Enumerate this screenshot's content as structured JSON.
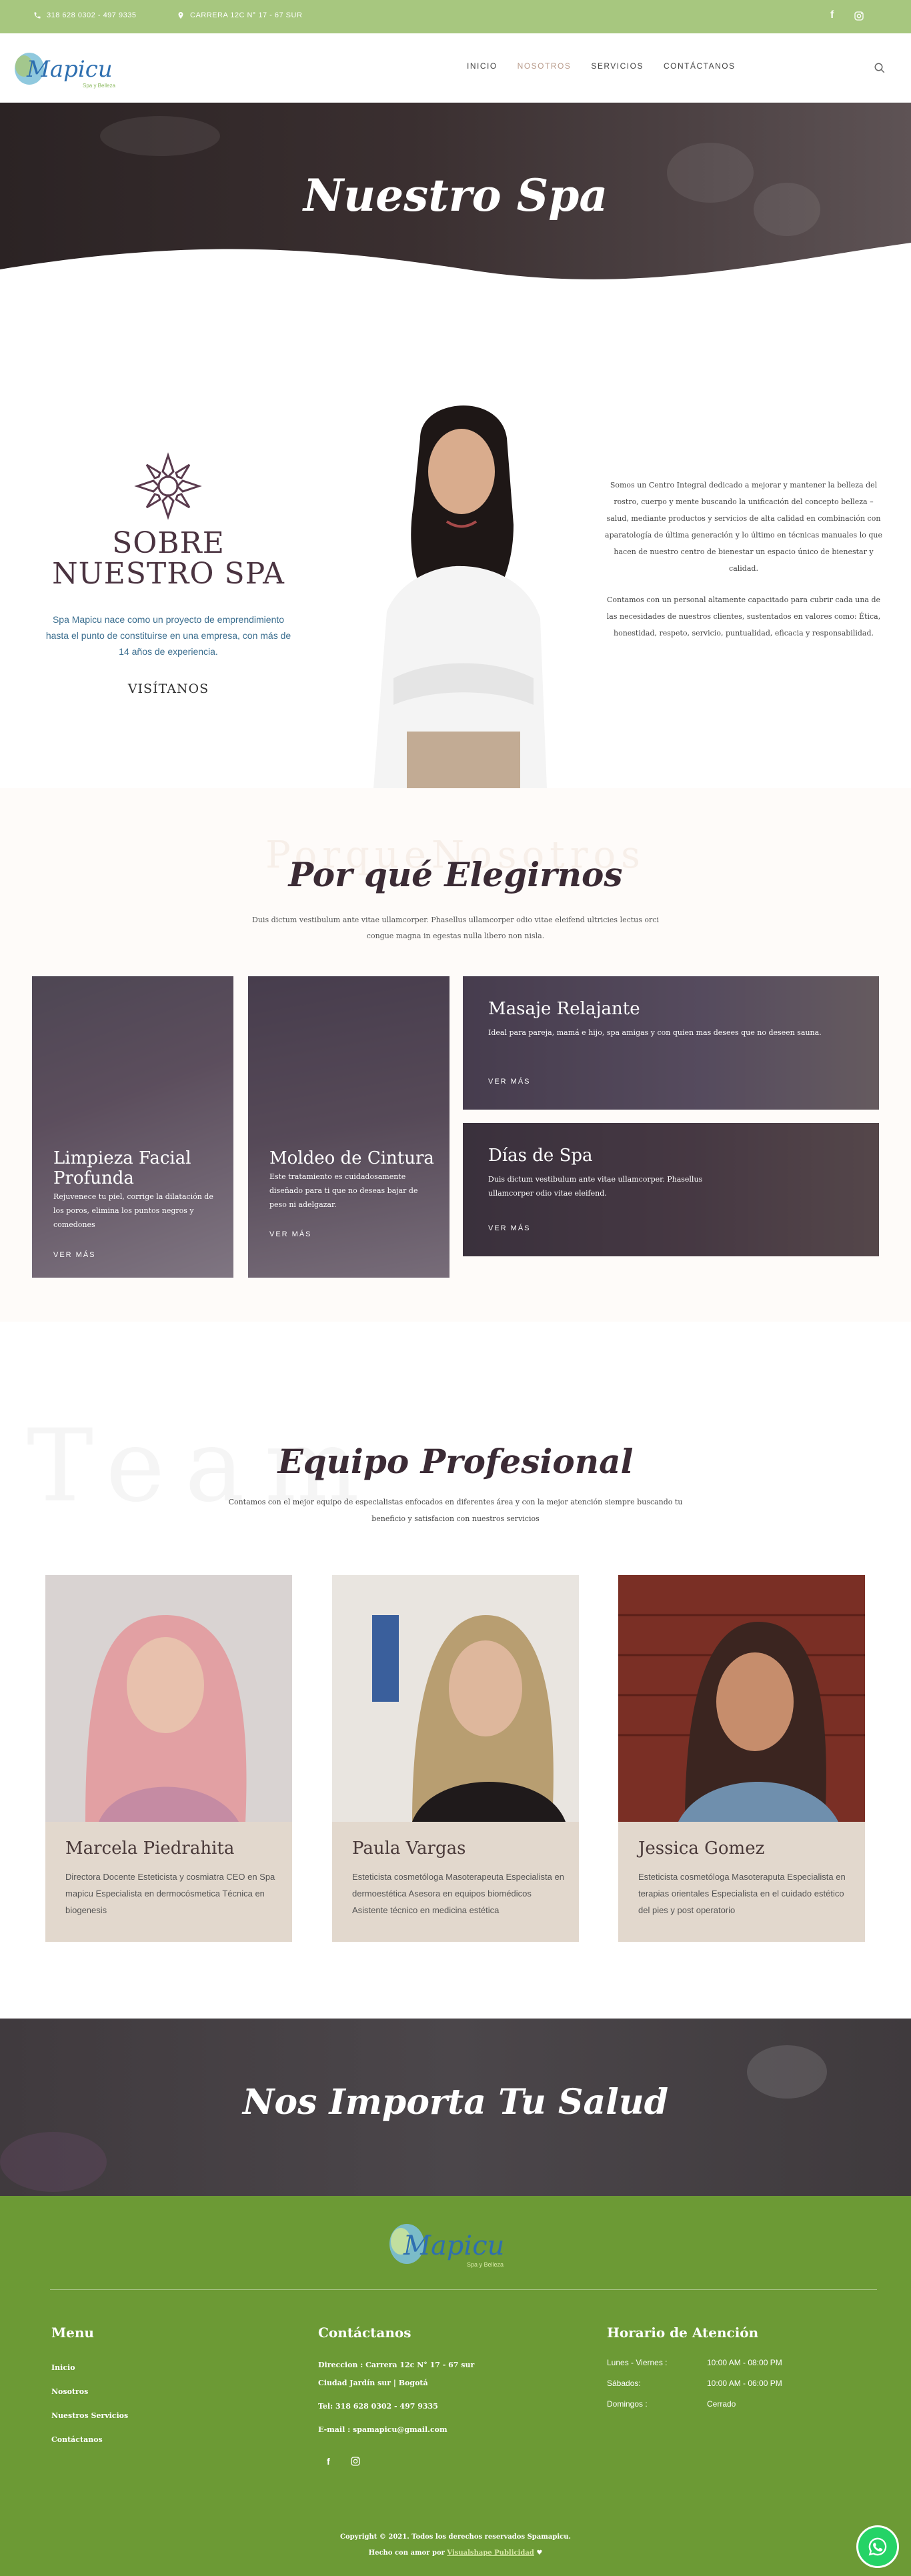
{
  "topbar": {
    "phone": "318 628 0302 - 497 9335",
    "address": "CARRERA 12C N° 17 - 67 SUR"
  },
  "header": {
    "logo_text": "Mapicu",
    "logo_tagline": "Spa y Belleza",
    "nav": [
      "INICIO",
      "NOSOTROS",
      "SERVICIOS",
      "CONTÁCTANOS"
    ],
    "active_nav": "NOSOTROS"
  },
  "hero": {
    "title": "Nuestro Spa"
  },
  "about": {
    "title_line1": "SOBRE",
    "title_line2": "NUESTRO SPA",
    "intro": "Spa Mapicu nace como un proyecto de emprendimiento hasta el punto de constituirse en una empresa, con más de 14 años de experiencia.",
    "visit_label": "VISÍTANOS",
    "right_p1": "Somos un Centro Integral dedicado a mejorar y mantener la belleza del rostro, cuerpo y mente buscando la unificación del concepto belleza – salud, mediante productos y servicios de alta calidad en combinación con aparatología de última generación y lo último en técnicas manuales lo que hacen de nuestro centro de bienestar un espacio único de bienestar y calidad.",
    "right_p2": "Contamos con un personal altamente capacitado para cubrir cada una de las necesidades de nuestros clientes, sustentados en valores como: Ética, honestidad, respeto, servicio, puntualidad, eficacia y responsabilidad."
  },
  "why": {
    "ghost": "PorqueNosotros",
    "title": "Por qué Elegirnos",
    "subtitle": "Duis dictum vestibulum ante vitae ullamcorper. Phasellus ullamcorper odio vitae eleifend ultricies lectus orci congue magna in egestas nulla libero non nisla.",
    "cards": [
      {
        "title": "Limpieza Facial Profunda",
        "text": "Rejuvenece tu piel, corrige la dilatación de los poros, elimina los puntos negros y comedones",
        "more": "VER MÁS"
      },
      {
        "title": "Moldeo de Cintura",
        "text": "Este tratamiento es cuidadosamente diseñado para ti que no deseas bajar de peso ni adelgazar.",
        "more": "VER MÁS"
      },
      {
        "title": "Masaje Relajante",
        "text": "Ideal para pareja, mamá e hijo, spa amigas y con quien mas desees que no deseen sauna.",
        "more": "VER MÁS"
      },
      {
        "title": "Días de Spa",
        "text": "Duis dictum vestibulum ante vitae ullamcorper. Phasellus ullamcorper odio vitae eleifend.",
        "more": "VER MÁS"
      }
    ]
  },
  "team": {
    "ghost": "Team",
    "title": "Equipo Profesional",
    "subtitle": "Contamos con el mejor equipo de especialistas enfocados en diferentes área y con la mejor atención siempre buscando tu beneficio y satisfacion con nuestros servicios",
    "members": [
      {
        "name": "Marcela Piedrahita",
        "bio": "Directora Docente Esteticista y cosmiatra CEO en Spa mapicu Especialista en dermocósmetica Técnica en biogenesis"
      },
      {
        "name": "Paula Vargas",
        "bio": "Esteticista cosmetóloga Masoterapeuta Especialista en dermoestética Asesora en equipos biomédicos Asistente técnico en medicina estética"
      },
      {
        "name": "Jessica Gomez",
        "bio": "Esteticista cosmetóloga Masoteraputa Especialista en terapias orientales Especialista en el cuidado estético del pies y post operatorio"
      }
    ]
  },
  "banner": {
    "title": "Nos Importa Tu Salud"
  },
  "footer": {
    "menu_title": "Menu",
    "menu": [
      "Inicio",
      "Nosotros",
      "Nuestros Servicios",
      "Contáctanos"
    ],
    "contact_title": "Contáctanos",
    "contact_address": "Direccion : Carrera 12c N° 17 - 67 sur",
    "contact_city": "Ciudad Jardín sur | Bogotá",
    "contact_tel": "Tel: 318 628 0302 - 497 9335",
    "contact_email": "E-mail : spamapicu@gmail.com",
    "hours_title": "Horario de Atención",
    "hours": [
      {
        "day": "Lunes - Viernes :",
        "time": "10:00 AM - 08:00 PM"
      },
      {
        "day": "Sábados:",
        "time": "10:00 AM - 06:00 PM"
      },
      {
        "day": "Domingos :",
        "time": "Cerrado"
      }
    ],
    "copyright": "Copyright © 2021. Todos los derechos reservados Spamapicu.",
    "made_by_prefix": "Hecho con amor por",
    "made_by_link": "Visualshape Publicidad"
  },
  "colors": {
    "topbar": "#a7c77f",
    "footer": "#6c9a35",
    "title_purple": "#4a3340",
    "card_beige": "#e2d8cd"
  }
}
